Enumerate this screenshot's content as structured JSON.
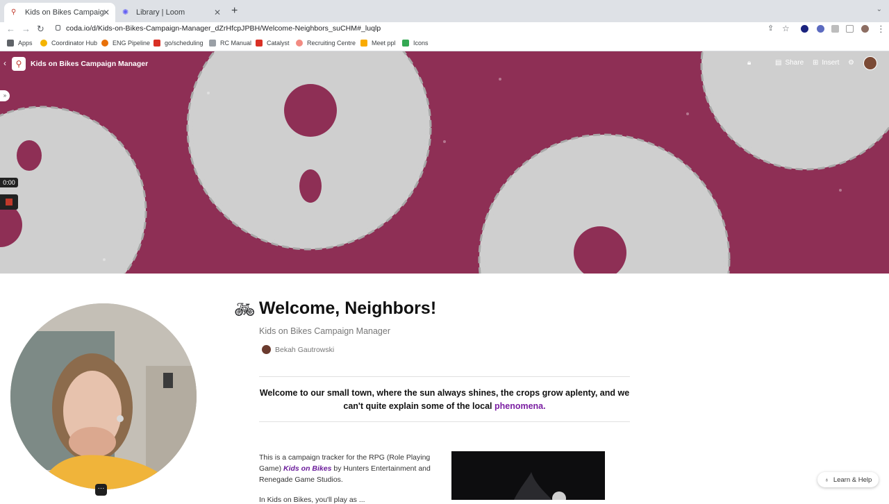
{
  "browser": {
    "tabs": [
      {
        "label": "Kids on Bikes Campaign Mana",
        "active": true
      },
      {
        "label": "Library | Loom",
        "active": false
      }
    ],
    "new_tab_icon": "plus-icon",
    "url": "coda.io/d/Kids-on-Bikes-Campaign-Manager_dZrHfcpJPBH/Welcome-Neighbors_suCHM#_luqlp",
    "bookmarks": [
      {
        "label": "Apps",
        "color": "#5f6368"
      },
      {
        "label": "Coordinator Hub",
        "color": "#f4b400"
      },
      {
        "label": "ENG Pipeline",
        "color": "#e8710a"
      },
      {
        "label": "go/scheduling",
        "color": "#d93025"
      },
      {
        "label": "RC Manual",
        "color": "#9aa0a6"
      },
      {
        "label": "Catalyst",
        "color": "#d93025"
      },
      {
        "label": "Recruiting Centre",
        "color": "#f28b82"
      },
      {
        "label": "Meet ppl",
        "color": "#f9ab00"
      },
      {
        "label": "Icons",
        "color": "#34a853"
      }
    ]
  },
  "doc": {
    "title": "Kids on Bikes Campaign Manager",
    "share_label": "Share",
    "insert_label": "Insert",
    "accent_color": "#8e2f55"
  },
  "recorder": {
    "time": "0:00"
  },
  "page": {
    "title": "Welcome, Neighbors!",
    "subtitle": "Kids on Bikes Campaign Manager",
    "author": "Bekah Gautrowski",
    "intro_text": "Welcome to our small town, where the sun always shines, the crops grow aplenty, and we can't quite explain some of the local ",
    "intro_link": "phenomena.",
    "body_before_link": "This is a campaign tracker for the RPG (Role Playing Game) ",
    "body_link": "Kids on Bikes",
    "body_after_link": " by Hunters Entertainment and Renegade Game Studios.",
    "body_next_line": "In Kids on Bikes, you'll play as ..."
  },
  "help": {
    "label": "Learn & Help"
  }
}
